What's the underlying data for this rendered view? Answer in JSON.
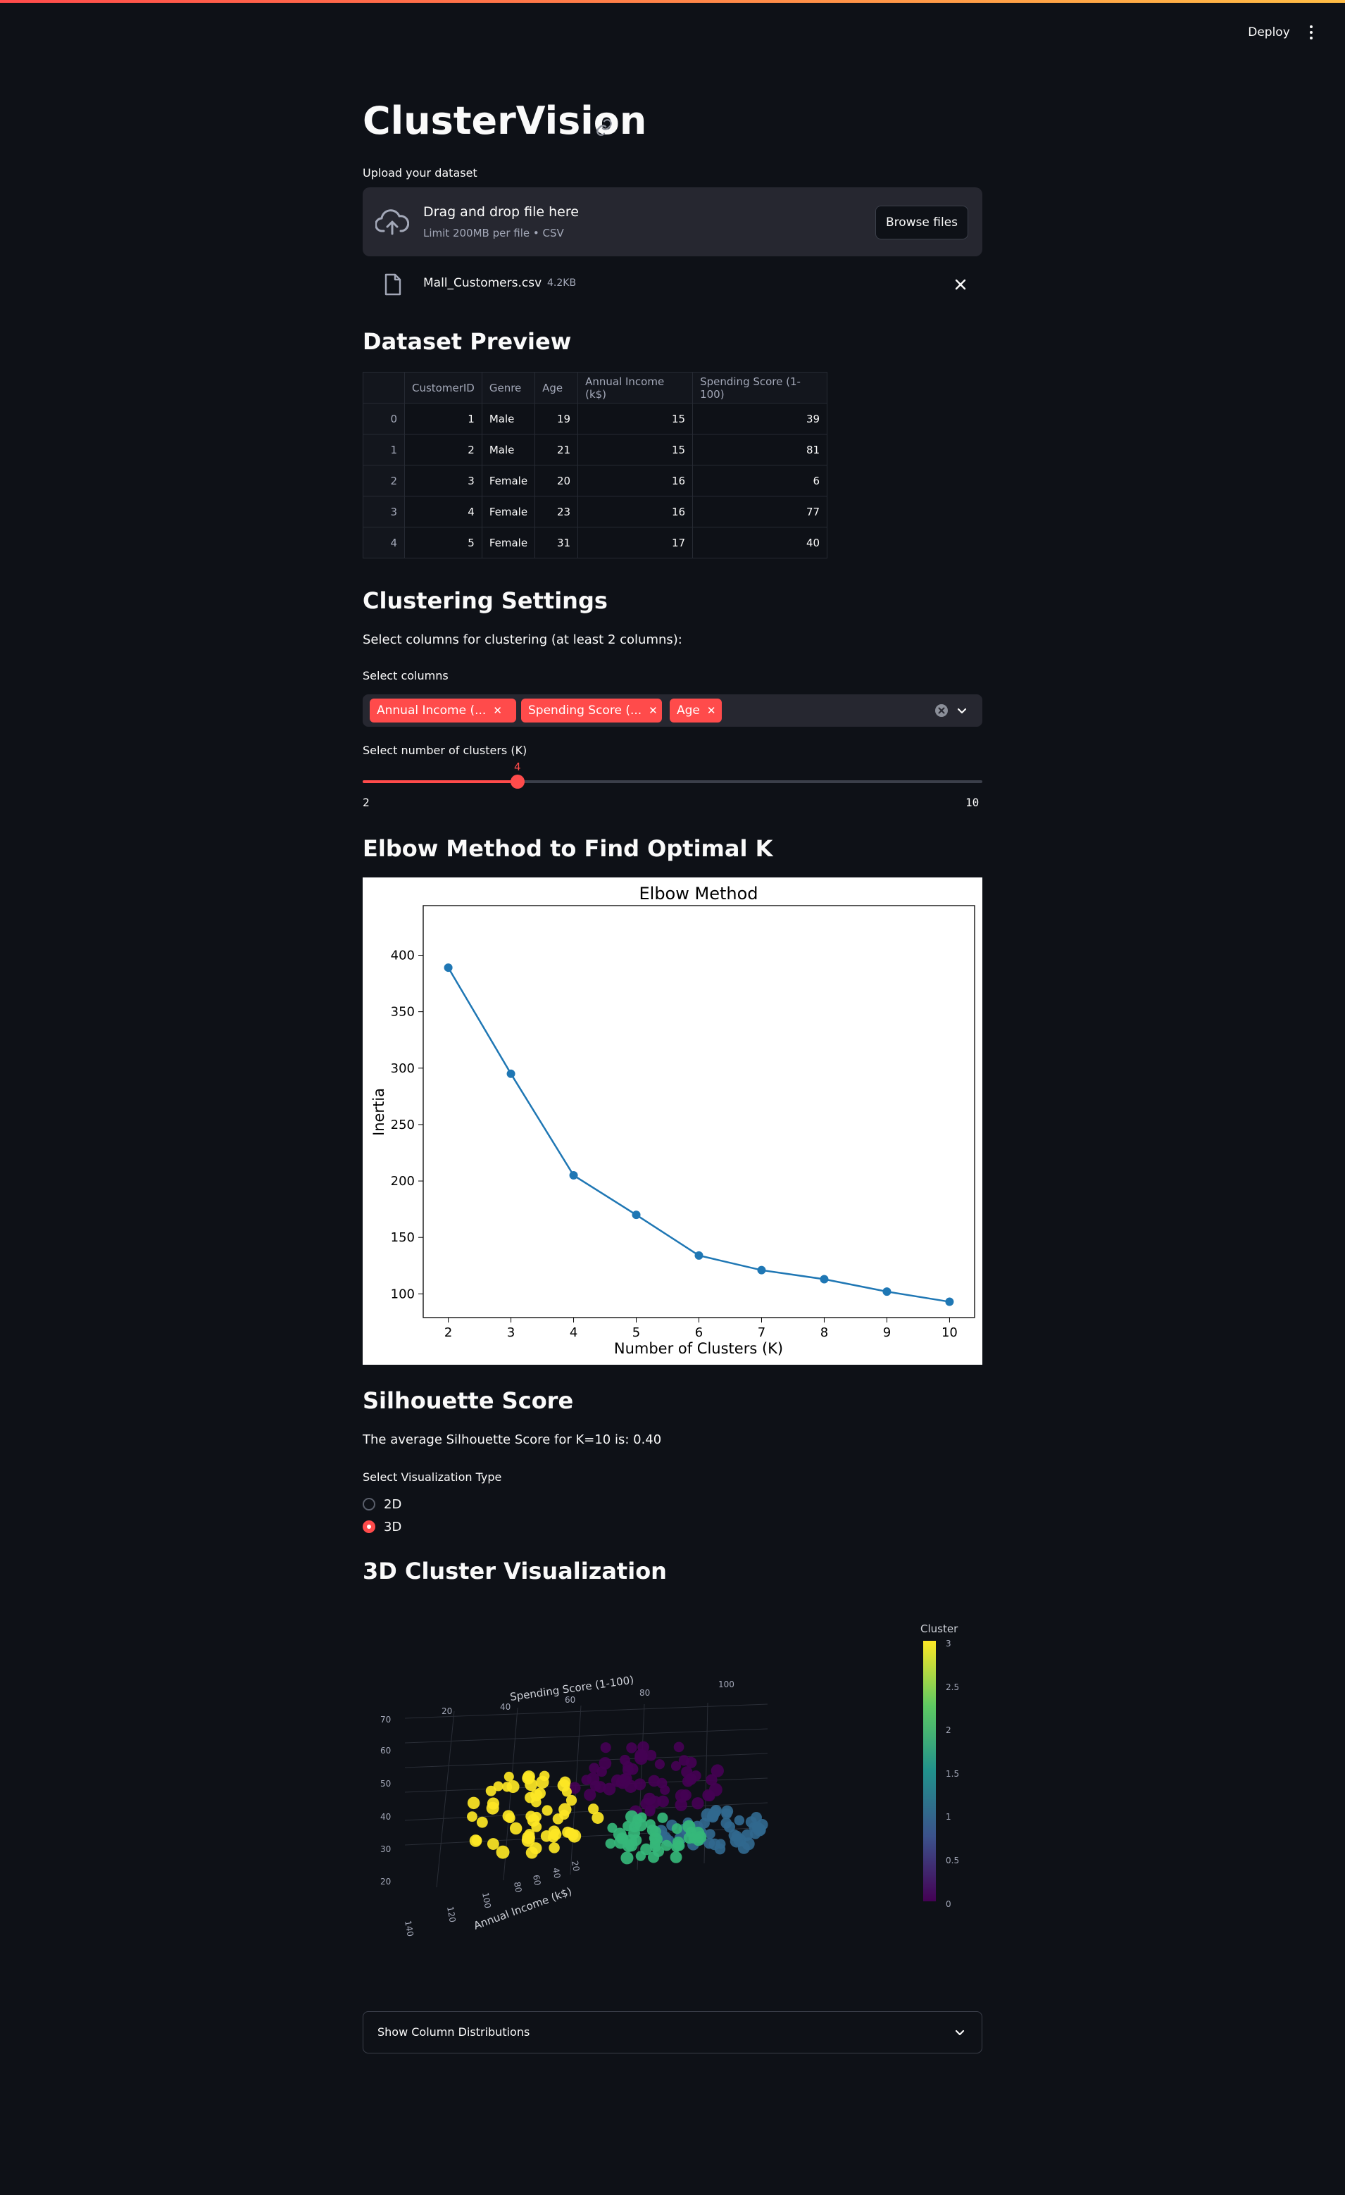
{
  "header": {
    "deploy_label": "Deploy"
  },
  "page": {
    "title": "ClusterVision"
  },
  "upload": {
    "label": "Upload your dataset",
    "drop_text": "Drag and drop file here",
    "limit_text": "Limit 200MB per file • CSV",
    "browse_label": "Browse files",
    "file": {
      "name": "Mall_Customers.csv",
      "size": "4.2KB"
    }
  },
  "preview": {
    "heading": "Dataset Preview",
    "columns": [
      "CustomerID",
      "Genre",
      "Age",
      "Annual Income (k$)",
      "Spending Score (1-100)"
    ],
    "rows": [
      {
        "index": "0",
        "cells": [
          "1",
          "Male",
          "19",
          "15",
          "39"
        ]
      },
      {
        "index": "1",
        "cells": [
          "2",
          "Male",
          "21",
          "15",
          "81"
        ]
      },
      {
        "index": "2",
        "cells": [
          "3",
          "Female",
          "20",
          "16",
          "6"
        ]
      },
      {
        "index": "3",
        "cells": [
          "4",
          "Female",
          "23",
          "16",
          "77"
        ]
      },
      {
        "index": "4",
        "cells": [
          "5",
          "Female",
          "31",
          "17",
          "40"
        ]
      }
    ]
  },
  "settings": {
    "heading": "Clustering Settings",
    "instruction": "Select columns for clustering (at least 2 columns):",
    "select_label": "Select columns",
    "selected_tags": [
      "Annual Income (...",
      "Spending Score (...",
      "Age"
    ],
    "slider_label": "Select number of clusters (K)",
    "slider_value": "4",
    "slider_min": "2",
    "slider_max": "10"
  },
  "elbow": {
    "heading": "Elbow Method to Find Optimal K"
  },
  "chart_data": {
    "type": "line",
    "title": "Elbow Method",
    "xlabel": "Number of Clusters (K)",
    "ylabel": "Inertia",
    "x": [
      2,
      3,
      4,
      5,
      6,
      7,
      8,
      9,
      10
    ],
    "y": [
      389,
      295,
      205,
      170,
      134,
      121,
      113,
      102,
      93
    ],
    "xlim": [
      1.6,
      10.4
    ],
    "ylim": [
      79,
      444
    ],
    "xticks": [
      "2",
      "3",
      "4",
      "5",
      "6",
      "7",
      "8",
      "9",
      "10"
    ],
    "yticks": [
      "100",
      "150",
      "200",
      "250",
      "300",
      "350",
      "400"
    ],
    "color": "#1f77b4",
    "grid": false
  },
  "silhouette": {
    "heading": "Silhouette Score",
    "text": "The average Silhouette Score for K=10 is: 0.40"
  },
  "viz": {
    "label": "Select Visualization Type",
    "options": [
      "2D",
      "3D"
    ],
    "selected": "3D",
    "heading": "3D Cluster Visualization"
  },
  "scatter3d": {
    "colorbar_title": "Cluster",
    "colorbar_ticks": [
      "3",
      "2.5",
      "2",
      "1.5",
      "1",
      "0.5",
      "0"
    ],
    "axis_y_title": "Spending Score (1-100)",
    "axis_y_ticks": [
      "20",
      "40",
      "60",
      "80",
      "100"
    ],
    "axis_x_title": "Annual Income (k$)",
    "axis_x_ticks": [
      "140",
      "120",
      "100",
      "80",
      "60",
      "40",
      "20"
    ],
    "axis_z_ticks": [
      "70",
      "60",
      "50",
      "40",
      "30",
      "20"
    ],
    "colors": {
      "c0": "#440154",
      "c1": "#31688e",
      "c2": "#35b779",
      "c3": "#fde725"
    }
  },
  "expander": {
    "label": "Show Column Distributions"
  }
}
